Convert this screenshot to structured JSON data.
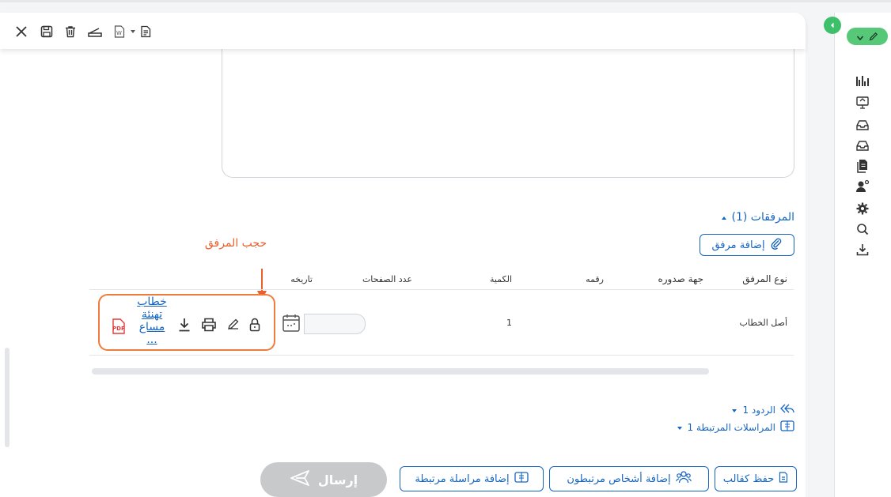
{
  "attachments": {
    "title": "المرفقات (1)",
    "add_button": "إضافة مرفق",
    "columns": [
      "نوع المرفق",
      "جهة صدوره",
      "رقمه",
      "الكمية",
      "عدد الصفحات",
      "تاريخه"
    ],
    "row": {
      "type": "أصل الخطاب",
      "issuer": "",
      "number": "",
      "quantity": "1",
      "pages": "",
      "date": "",
      "file_name": "خطاب تهنئة مساع ..."
    }
  },
  "annotation": {
    "label": "حجب المرفق",
    "color": "#e8612c"
  },
  "links": {
    "replies": "الردود 1",
    "related": "المراسلات المرتبطة 1"
  },
  "bottom_buttons": {
    "save_template": "حفظ كقالب",
    "add_people": "إضافة أشخاص مرتبطون",
    "add_related": "إضافة مراسلة مرتبطة",
    "send": "إرسال"
  },
  "toolbar_icons": [
    "close-icon",
    "save-icon",
    "delete-icon",
    "scanner-icon",
    "word-template-icon",
    "copy-icon"
  ],
  "sidebar_icons": [
    "chart-icon",
    "monitor-icon",
    "inbox-icon",
    "outbox-icon",
    "documents-icon",
    "user-settings-icon",
    "gear-icon",
    "search-icon",
    "download-icon"
  ],
  "colors": {
    "primary": "#1565c0",
    "highlight": "#ee7c3c",
    "green": "#57c878",
    "send_disabled": "#c8c9cb",
    "pdf": "#e53935"
  }
}
